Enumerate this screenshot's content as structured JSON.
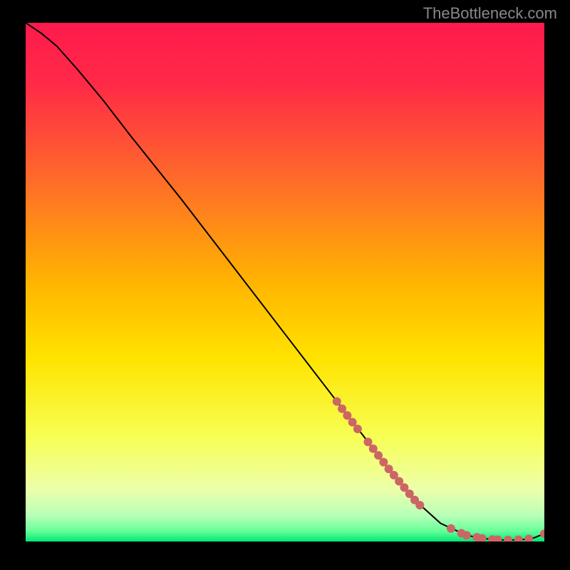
{
  "watermark": "TheBottleneck.com",
  "chart_data": {
    "type": "line",
    "title": "",
    "xlabel": "",
    "ylabel": "",
    "xlim": [
      0,
      100
    ],
    "ylim": [
      0,
      100
    ],
    "grid": false,
    "legend": false,
    "background_gradient": {
      "top": "#ff1a4d",
      "upper_mid": "#ff6a2a",
      "mid": "#ffd400",
      "lower_mid": "#f7ff66",
      "near_bottom": "#d4ffb0",
      "bottom": "#00e676"
    },
    "series": [
      {
        "name": "curve",
        "type": "line",
        "color": "#000000",
        "x": [
          0,
          3,
          6,
          10,
          15,
          20,
          30,
          40,
          50,
          60,
          70,
          75,
          80,
          85,
          88,
          90,
          92,
          94,
          96,
          98,
          100
        ],
        "y": [
          100,
          98,
          95.5,
          91,
          85,
          78.5,
          66,
          53,
          40,
          27,
          14,
          8,
          3.5,
          1.2,
          0.6,
          0.4,
          0.3,
          0.3,
          0.4,
          0.7,
          1.5
        ]
      },
      {
        "name": "highlight-dots",
        "type": "scatter",
        "color": "#cc6666",
        "x": [
          60,
          61,
          62,
          63,
          64,
          66,
          67,
          68,
          69,
          70,
          71,
          72,
          73,
          74,
          75,
          76,
          82,
          84,
          85,
          87,
          88,
          90,
          91,
          93,
          95,
          97,
          100
        ],
        "y": [
          27,
          25.6,
          24.3,
          23,
          21.7,
          19.2,
          17.9,
          16.6,
          15.3,
          14,
          12.8,
          11.6,
          10.4,
          9.2,
          8,
          7,
          2.5,
          1.6,
          1.2,
          0.8,
          0.6,
          0.4,
          0.35,
          0.3,
          0.35,
          0.5,
          1.5
        ]
      }
    ]
  }
}
